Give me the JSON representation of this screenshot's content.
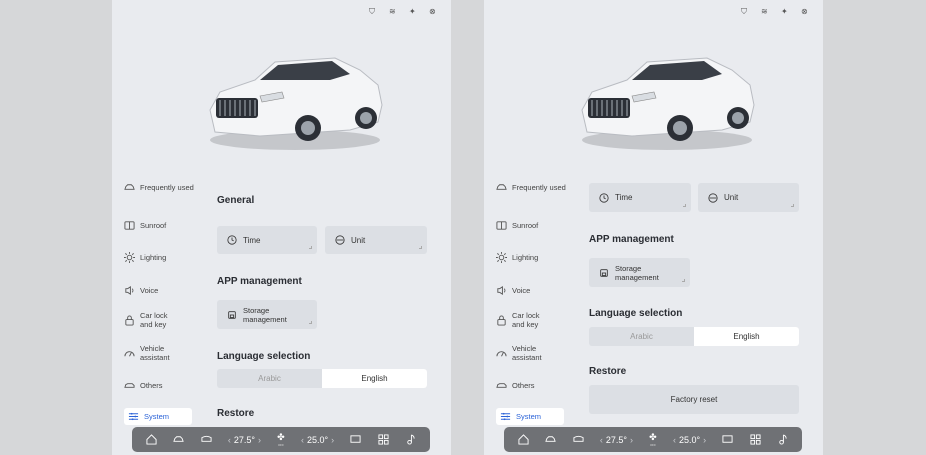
{
  "panels": [
    {
      "sidebar": {
        "items": [
          {
            "label": "Frequently used",
            "icon": "car-icon"
          },
          {
            "label": "Sunroof",
            "icon": "sunroof-icon"
          },
          {
            "label": "Lighting",
            "icon": "light-icon"
          },
          {
            "label": "Voice",
            "icon": "voice-icon"
          },
          {
            "label": "Car lock and key",
            "icon": "lock-icon"
          },
          {
            "label": "Vehicle assistant",
            "icon": "gauge-icon"
          },
          {
            "label": "Others",
            "icon": "others-car-icon"
          },
          {
            "label": "System",
            "icon": "sliders-icon",
            "active": true
          }
        ]
      },
      "general_title": "General",
      "time_label": "Time",
      "unit_label": "Unit",
      "app_title": "APP management",
      "storage_label": "Storage management",
      "language_title": "Language selection",
      "lang_options": [
        "Arabic",
        "English"
      ],
      "lang_selected": "English",
      "restore_title": "Restore"
    },
    {
      "sidebar": {
        "items": [
          {
            "label": "Frequently used",
            "icon": "car-icon"
          },
          {
            "label": "Sunroof",
            "icon": "sunroof-icon"
          },
          {
            "label": "Lighting",
            "icon": "light-icon"
          },
          {
            "label": "Voice",
            "icon": "voice-icon"
          },
          {
            "label": "Car lock and key",
            "icon": "lock-icon"
          },
          {
            "label": "Vehicle assistant",
            "icon": "gauge-icon"
          },
          {
            "label": "Others",
            "icon": "others-car-icon"
          },
          {
            "label": "System",
            "icon": "sliders-icon",
            "active": true
          }
        ]
      },
      "time_label": "Time",
      "unit_label": "Unit",
      "app_title": "APP management",
      "storage_label": "Storage management",
      "language_title": "Language selection",
      "lang_options": [
        "Arabic",
        "English"
      ],
      "lang_selected": "English",
      "restore_title": "Restore",
      "factory_reset_label": "Factory reset"
    }
  ],
  "bottombar": {
    "temp_left": "27.5°",
    "temp_right": "25.0°",
    "fan_sub": "OFF"
  },
  "colors": {
    "panel_bg": "#e9ebef",
    "card_bg": "#dcdfe4",
    "active_accent": "#2b63d8",
    "bottombar_bg": "#6f7175"
  }
}
